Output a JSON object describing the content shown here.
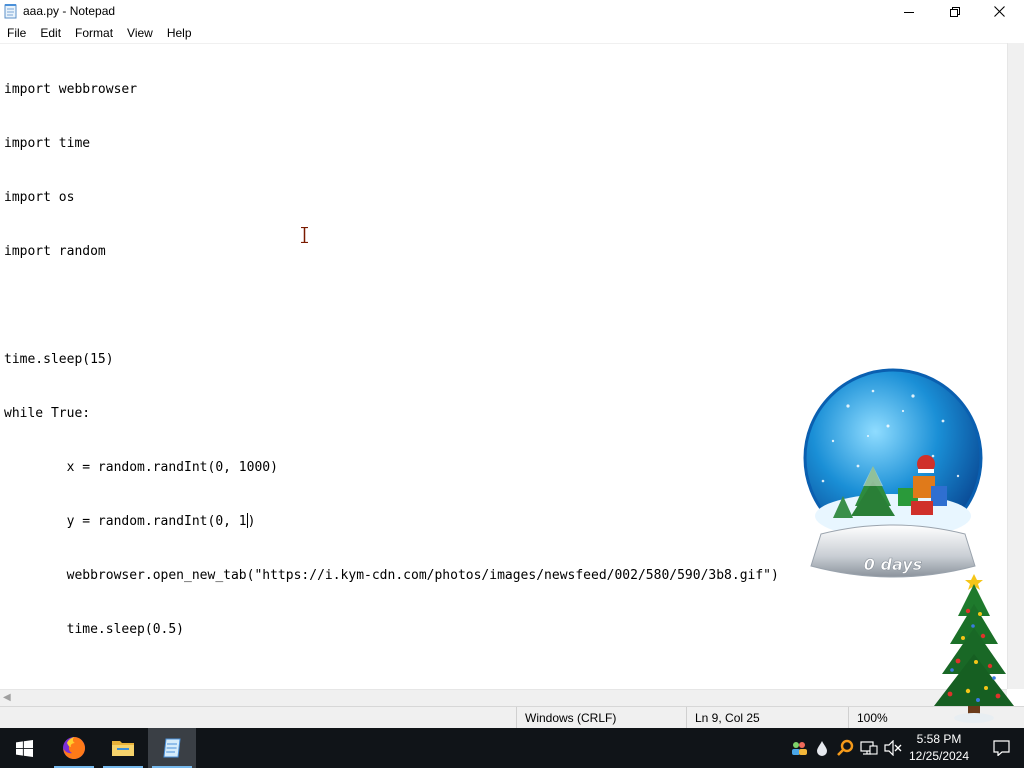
{
  "window": {
    "title": "aaa.py - Notepad",
    "icon": "notepad-icon",
    "controls": [
      "minimize-icon",
      "maximize-icon",
      "close-icon"
    ]
  },
  "menu": {
    "file": "File",
    "edit": "Edit",
    "format": "Format",
    "view": "View",
    "help": "Help"
  },
  "editor": {
    "lines": [
      "import webbrowser",
      "import time",
      "import os",
      "import random",
      "",
      "time.sleep(15)",
      "while True:",
      "        x = random.randInt(0, 1000)",
      "        y = random.randInt(0, 1",
      "        webbrowser.open_new_tab(\"https://i.kym-cdn.com/photos/images/newsfeed/002/580/590/3b8.gif\")",
      "        time.sleep(0.5)"
    ],
    "caret_line_after": ")"
  },
  "status": {
    "encoding": "Windows (CRLF)",
    "position": "Ln 9, Col 25",
    "zoom": "100%"
  },
  "desktop": {
    "snow_globe_label": "0 days"
  },
  "taskbar": {
    "apps": [
      "windows-start-icon",
      "firefox-icon",
      "file-explorer-icon",
      "notepad-icon"
    ],
    "tray_icons": [
      "people-icon",
      "water-drop-icon",
      "search-key-icon",
      "network-icon",
      "volume-muted-icon"
    ],
    "time": "5:58 PM",
    "date": "12/25/2024"
  },
  "colors": {
    "taskbar_bg": "#101418",
    "active_indicator": "#76b9ed",
    "globe_blue": "#1a8fd6"
  }
}
